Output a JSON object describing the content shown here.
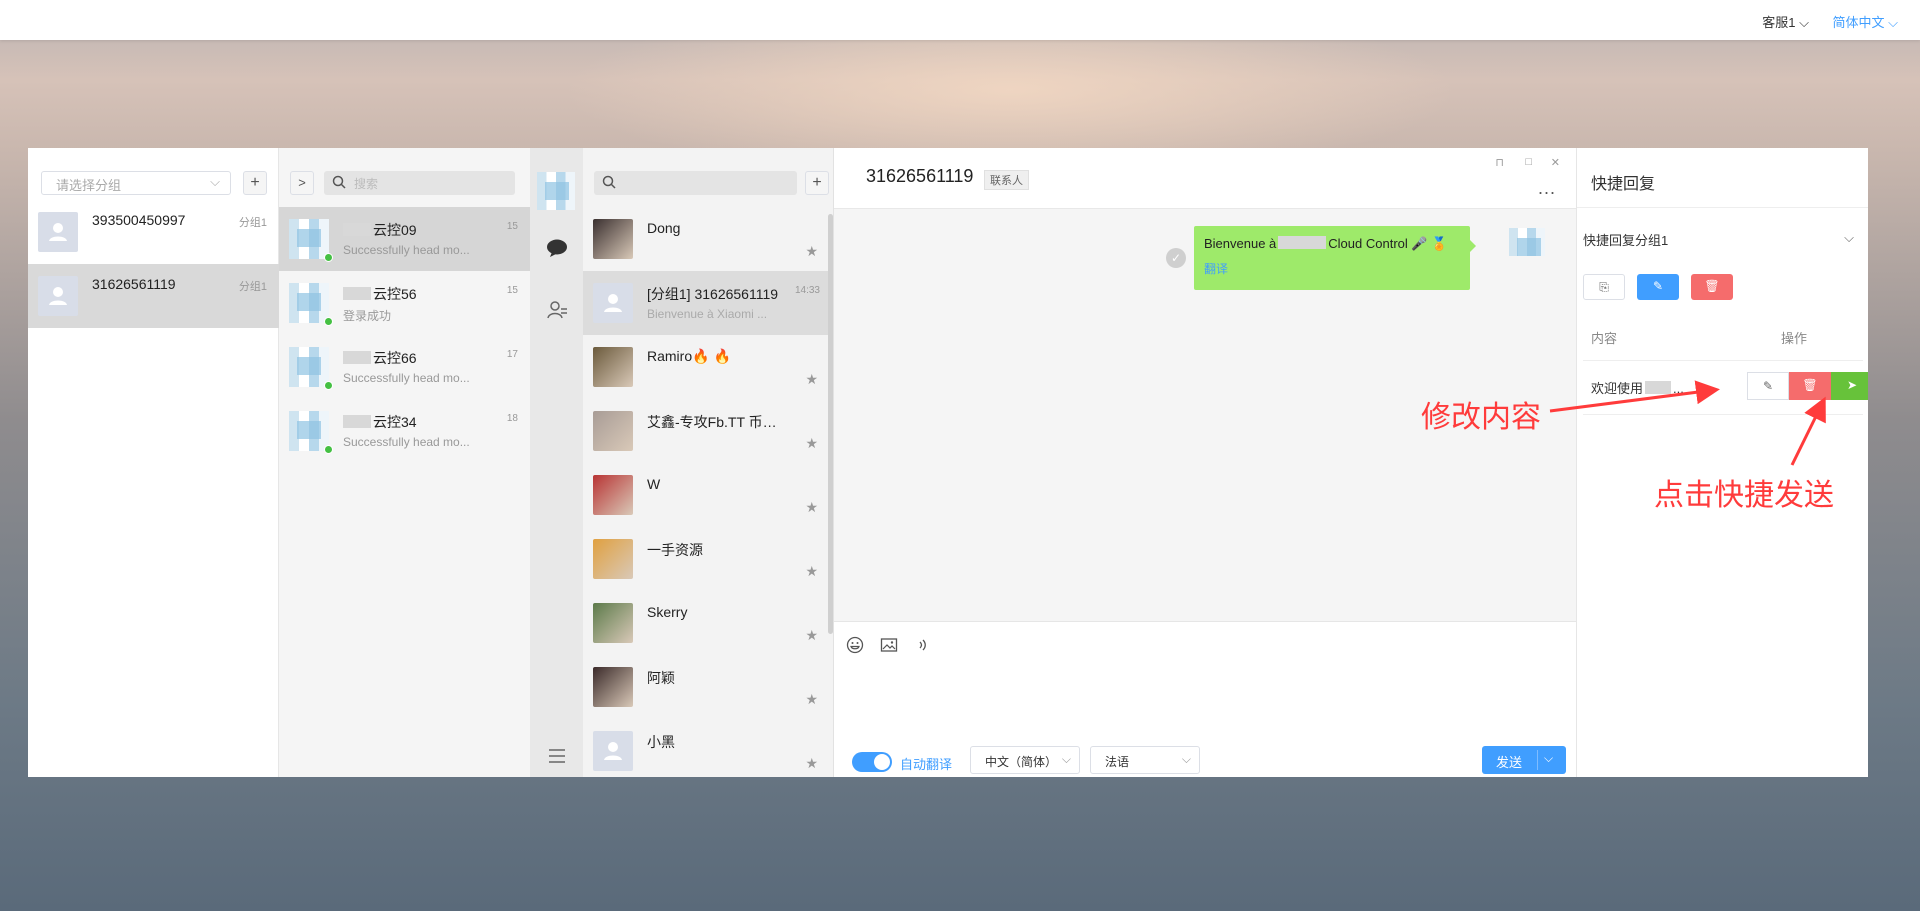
{
  "topbar": {
    "service": "客服1",
    "language": "简体中文"
  },
  "groups_panel": {
    "select_placeholder": "请选择分组",
    "add_label": "+",
    "accounts": [
      {
        "number": "393500450997",
        "group": "分组1",
        "selected": false
      },
      {
        "number": "31626561119",
        "group": "分组1",
        "selected": true
      }
    ]
  },
  "devices_panel": {
    "expand_label": ">",
    "search_placeholder": "搜索",
    "devices": [
      {
        "name": "云控09",
        "message": "Successfully head mo...",
        "time": "15",
        "selected": true
      },
      {
        "name": "云控56",
        "message": "登录成功",
        "time": "15",
        "selected": false
      },
      {
        "name": "云控66",
        "message": "Successfully head mo...",
        "time": "17",
        "selected": false
      },
      {
        "name": "云控34",
        "message": "Successfully head mo...",
        "time": "18",
        "selected": false
      }
    ]
  },
  "nav_icons": [
    "chat-bubble-icon",
    "contacts-icon",
    "menu-icon"
  ],
  "contacts_panel": {
    "add_label": "+",
    "chats": [
      {
        "name": "Dong",
        "subtitle": "",
        "time": "",
        "selected": false,
        "photo": "#3a3030"
      },
      {
        "name": "[分组1] 31626561119",
        "subtitle": "Bienvenue à Xiaomi ...",
        "time": "14:33",
        "selected": true,
        "photo": ""
      },
      {
        "name": "Ramiro🔥 🔥",
        "subtitle": "",
        "time": "",
        "selected": false,
        "photo": "#6b5a3c"
      },
      {
        "name": "艾鑫-专攻Fb.TT 币…",
        "subtitle": "",
        "time": "",
        "selected": false,
        "photo": "#a89c96"
      },
      {
        "name": "W",
        "subtitle": "",
        "time": "",
        "selected": false,
        "photo": "#b83434"
      },
      {
        "name": "一手资源",
        "subtitle": "",
        "time": "",
        "selected": false,
        "photo": "#e0a040"
      },
      {
        "name": "Skerry",
        "subtitle": "",
        "time": "",
        "selected": false,
        "photo": "#5c7a4a"
      },
      {
        "name": "阿颖",
        "subtitle": "",
        "time": "",
        "selected": false,
        "photo": "#3b2a2a"
      },
      {
        "name": "小黑",
        "subtitle": "",
        "time": "",
        "selected": false,
        "photo": ""
      }
    ]
  },
  "chat": {
    "title": "31626561119",
    "tag": "联系人",
    "more": "...",
    "message_prefix": "Bienvenue à",
    "message_suffix": "Cloud Control 🎤 🏅",
    "translate_label": "翻译",
    "check": "✓",
    "auto_translate_label": "自动翻译",
    "source_lang": "中文（简体）",
    "target_lang": "法语",
    "send_label": "发送"
  },
  "quick_reply": {
    "title": "快捷回复",
    "group": "快捷回复分组1",
    "col_content": "内容",
    "col_action": "操作",
    "item_text": "欢迎使用",
    "ellipsis": "..."
  },
  "annotations": {
    "edit": "修改内容",
    "send": "点击快捷发送"
  },
  "colors": {
    "accent": "#409eff",
    "danger": "#f56c6c",
    "success": "#67c23a",
    "bubble": "#9eea6a",
    "annotation": "#ff3b3b"
  }
}
